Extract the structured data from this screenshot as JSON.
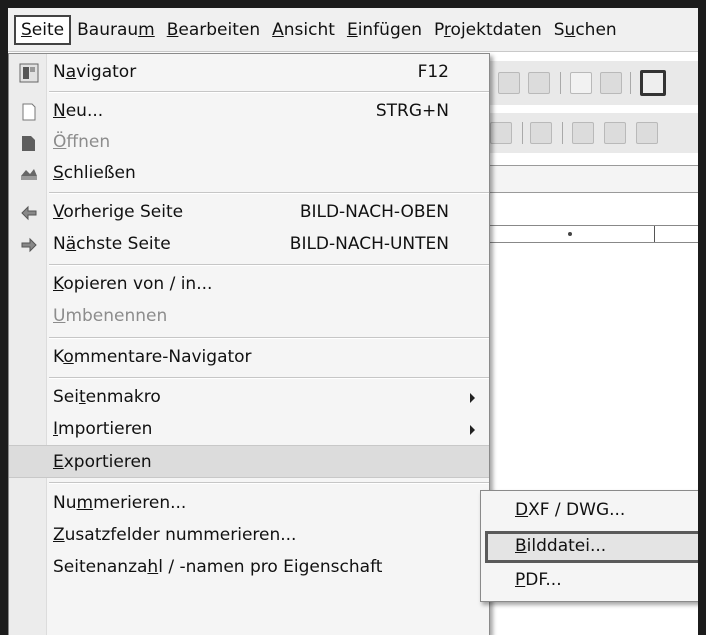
{
  "menubar": {
    "items": [
      {
        "pre": "",
        "u": "S",
        "post": "eite"
      },
      {
        "pre": "Baurau",
        "u": "m",
        "post": ""
      },
      {
        "pre": "",
        "u": "B",
        "post": "earbeiten"
      },
      {
        "pre": "",
        "u": "A",
        "post": "nsicht"
      },
      {
        "pre": "",
        "u": "E",
        "post": "infügen"
      },
      {
        "pre": "P",
        "u": "r",
        "post": "ojektdaten"
      },
      {
        "pre": "S",
        "u": "u",
        "post": "chen"
      }
    ]
  },
  "menu": {
    "navigator": {
      "pre": "N",
      "u": "a",
      "post": "vigator",
      "shortcut": "F12",
      "icon": "navigator-icon"
    },
    "neu": {
      "pre": "",
      "u": "N",
      "post": "eu...",
      "shortcut": "STRG+N",
      "icon": "new-page-icon"
    },
    "oeffnen": {
      "pre": "",
      "u": "Ö",
      "post": "ffnen",
      "icon": "open-icon"
    },
    "schliessen": {
      "pre": "",
      "u": "S",
      "post": "chließen",
      "icon": "close-icon"
    },
    "vorherige": {
      "pre": "",
      "u": "V",
      "post": "orherige Seite",
      "shortcut": "BILD-NACH-OBEN",
      "icon": "previous-page-icon"
    },
    "naechste": {
      "pre": "N",
      "u": "ä",
      "post": "chste Seite",
      "shortcut": "BILD-NACH-UNTEN",
      "icon": "next-page-icon"
    },
    "kopieren": {
      "pre": "",
      "u": "K",
      "post": "opieren von / in..."
    },
    "umbenennen": {
      "pre": "",
      "u": "U",
      "post": "mbenennen"
    },
    "kommentare": {
      "pre": "K",
      "u": "o",
      "post": "mmentare-Navigator"
    },
    "seitenmakro": {
      "pre": "Sei",
      "u": "t",
      "post": "enmakro"
    },
    "importieren": {
      "pre": "",
      "u": "I",
      "post": "mportieren"
    },
    "exportieren": {
      "pre": "",
      "u": "E",
      "post": "xportieren"
    },
    "nummerieren": {
      "pre": "Nu",
      "u": "m",
      "post": "merieren..."
    },
    "zusatzfelder": {
      "pre": "",
      "u": "Z",
      "post": "usatzfelder nummerieren..."
    },
    "seitenanzahl": {
      "pre": "Seitenanza",
      "u": "h",
      "post": "l / -namen pro Eigenschaft"
    }
  },
  "submenu": {
    "dxf": {
      "pre": "",
      "u": "D",
      "post": "XF / DWG..."
    },
    "bilddatei": {
      "pre": "",
      "u": "B",
      "post": "ilddatei..."
    },
    "pdf": {
      "pre": "",
      "u": "P",
      "post": "DF..."
    }
  }
}
